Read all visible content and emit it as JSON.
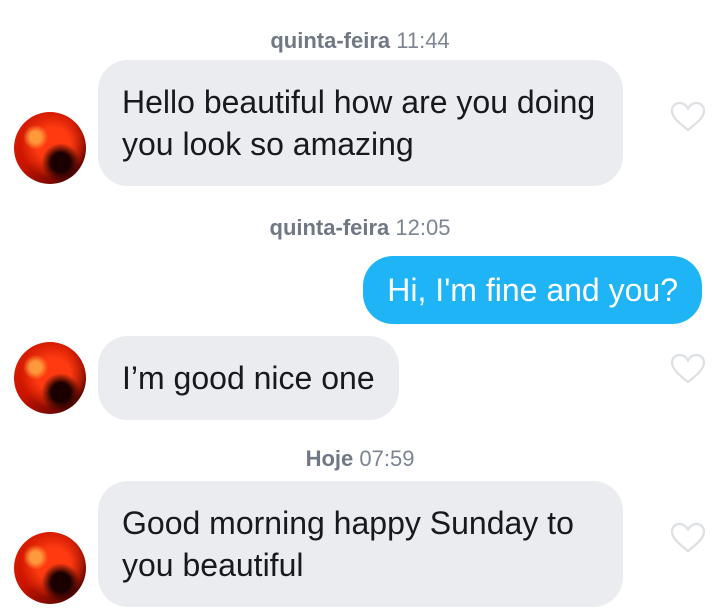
{
  "messages": [
    {
      "kind": "timestamp",
      "day": "quinta-feira",
      "time": "11:44"
    },
    {
      "kind": "incoming",
      "text": "Hello beautiful how are you doing you look so amazing"
    },
    {
      "kind": "timestamp",
      "day": "quinta-feira",
      "time": "12:05"
    },
    {
      "kind": "outgoing",
      "text": "Hi, I'm fine and you?"
    },
    {
      "kind": "incoming",
      "text": "I’m good nice one"
    },
    {
      "kind": "timestamp",
      "day": "Hoje",
      "time": "07:59"
    },
    {
      "kind": "incoming",
      "text": "Good morning happy Sunday to you beautiful"
    }
  ],
  "icons": {
    "avatar": "sender-avatar",
    "like": "heart-outline-icon"
  },
  "colors": {
    "incoming_bubble": "#eaecef",
    "outgoing_bubble": "#1fb4f5",
    "timestamp": "#7c8591"
  }
}
